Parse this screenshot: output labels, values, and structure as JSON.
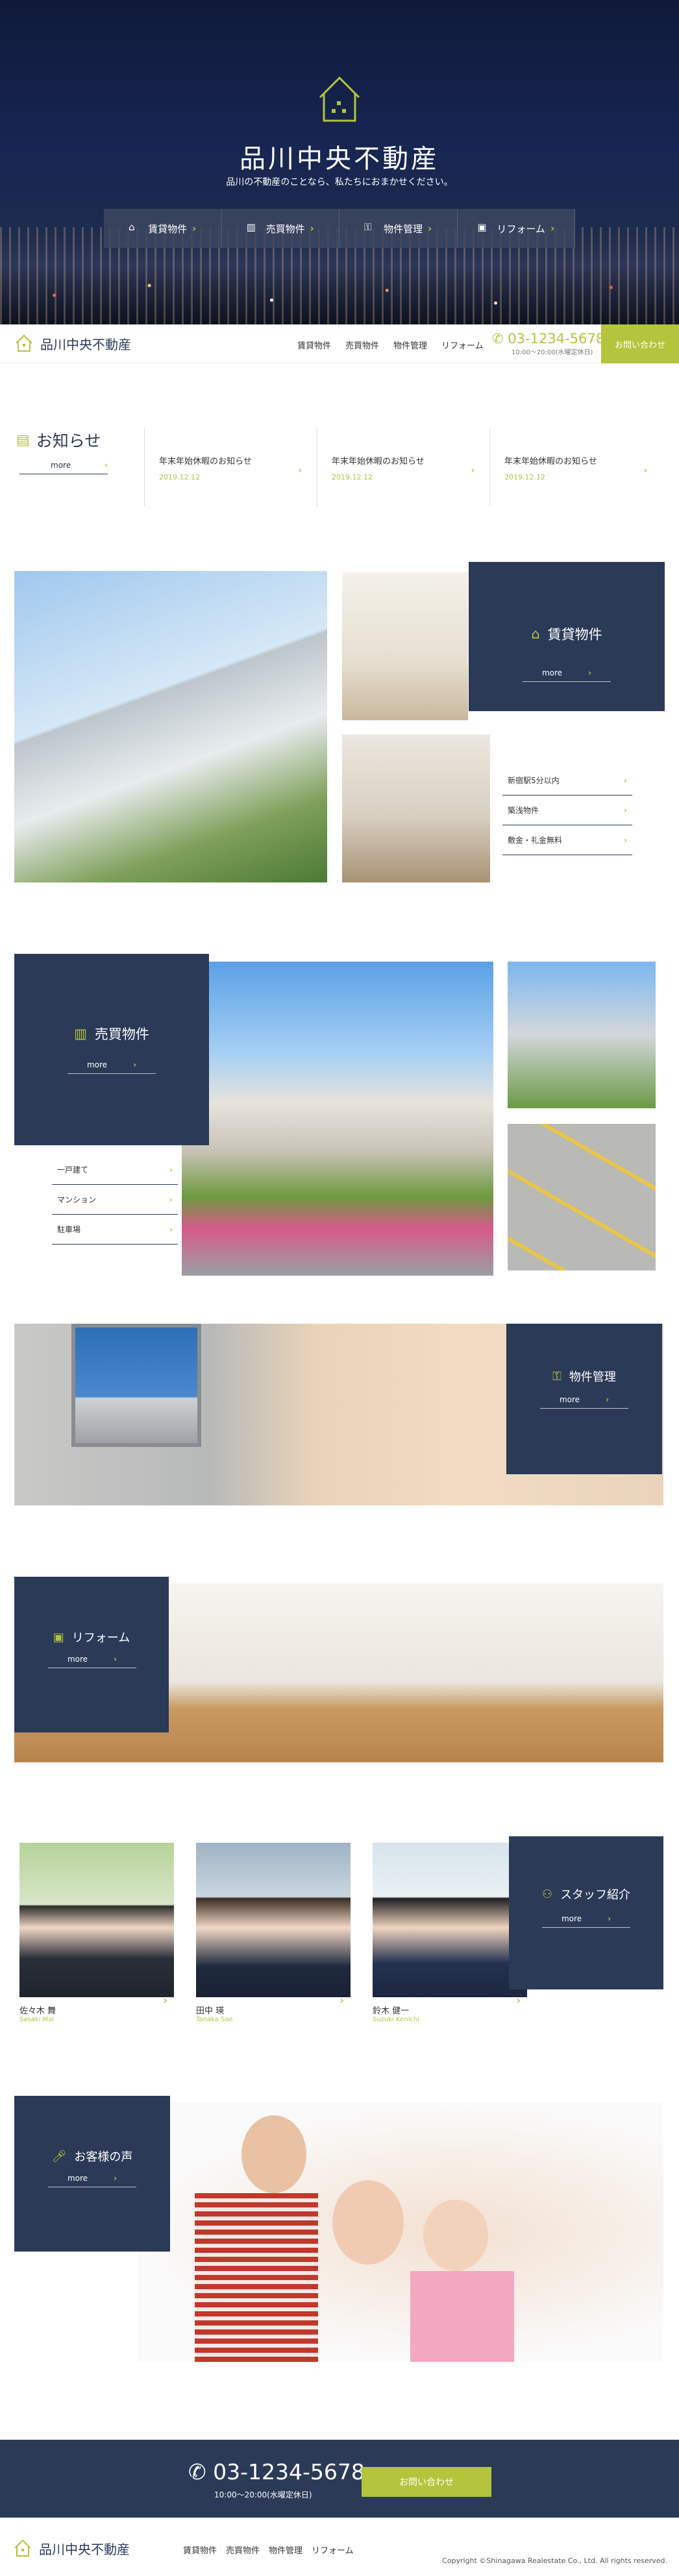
{
  "hero": {
    "title": "品川中央不動産",
    "subtitle": "品川の不動産のことなら、私たちにおまかせください。",
    "menu": [
      {
        "label": "賃貸物件",
        "icon": "house-icon"
      },
      {
        "label": "売買物件",
        "icon": "building-icon"
      },
      {
        "label": "物件管理",
        "icon": "key-icon"
      },
      {
        "label": "リフォーム",
        "icon": "box-icon"
      }
    ]
  },
  "header": {
    "brand": "品川中央不動産",
    "nav": [
      "賃貸物件",
      "売買物件",
      "物件管理",
      "リフォーム"
    ],
    "tel": "03-1234-5678",
    "hours": "10:00〜20:00(水曜定休日)",
    "contact": "お問い合わせ"
  },
  "news": {
    "title": "お知らせ",
    "more": "more",
    "items": [
      {
        "title": "年末年始休暇のお知らせ",
        "date": "2019.12.12"
      },
      {
        "title": "年末年始休暇のお知らせ",
        "date": "2019.12.12"
      },
      {
        "title": "年末年始休暇のお知らせ",
        "date": "2019.12.12"
      }
    ]
  },
  "rent": {
    "title": "賃貸物件",
    "more": "more",
    "links": [
      "新宿駅5分以内",
      "築浅物件",
      "敷金・礼金無料"
    ]
  },
  "sale": {
    "title": "売買物件",
    "more": "more",
    "links": [
      "一戸建て",
      "マンション",
      "駐車場"
    ]
  },
  "manage": {
    "title": "物件管理",
    "more": "more"
  },
  "reform": {
    "title": "リフォーム",
    "more": "more"
  },
  "staff": {
    "title": "スタッフ紹介",
    "more": "more",
    "members": [
      {
        "name": "佐々木 舞",
        "en": "Sasaki Mai"
      },
      {
        "name": "田中 瑛",
        "en": "Tanaka Sae"
      },
      {
        "name": "鈴木 健一",
        "en": "Suzuki Kenichi"
      }
    ]
  },
  "voice": {
    "title": "お客様の声",
    "more": "more"
  },
  "footer": {
    "tel": "03-1234-5678",
    "hours": "10:00〜20:00(水曜定休日)",
    "contact": "お問い合わせ",
    "brand": "品川中央不動産",
    "nav": [
      "賃貸物件",
      "売買物件",
      "物件管理",
      "リフォーム"
    ],
    "copyright": "Copyright ©Shinagawa Realestate Co., Ltd. All rights reserved."
  },
  "colors": {
    "navy": "#2b3a57",
    "accent": "#b4c43c"
  }
}
